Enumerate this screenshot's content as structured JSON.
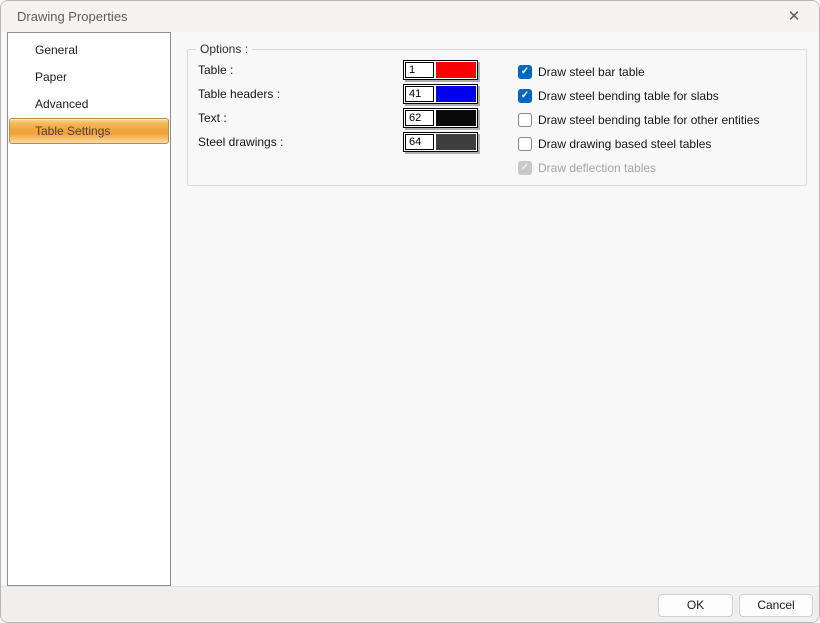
{
  "window": {
    "title": "Drawing Properties"
  },
  "icons": {
    "close": "✕",
    "check": "✓"
  },
  "sidebar": {
    "items": [
      {
        "label": "General",
        "selected": false
      },
      {
        "label": "Paper",
        "selected": false
      },
      {
        "label": "Advanced",
        "selected": false
      },
      {
        "label": "Table Settings",
        "selected": true
      }
    ]
  },
  "options": {
    "group_label": "Options :",
    "color_rows": [
      {
        "label": "Table :",
        "value": "1",
        "color": "#fb0000"
      },
      {
        "label": "Table headers :",
        "value": "41",
        "color": "#0000ee"
      },
      {
        "label": "Text :",
        "value": "62",
        "color": "#0a0a0a"
      },
      {
        "label": "Steel drawings :",
        "value": "64",
        "color": "#3e3e3e"
      }
    ],
    "checkboxes": [
      {
        "label": "Draw steel bar table",
        "checked": true,
        "disabled": false
      },
      {
        "label": "Draw steel bending table for slabs",
        "checked": true,
        "disabled": false
      },
      {
        "label": "Draw steel bending table for other entities",
        "checked": false,
        "disabled": false
      },
      {
        "label": "Draw drawing based steel tables",
        "checked": false,
        "disabled": false
      },
      {
        "label": "Draw deflection tables",
        "checked": true,
        "disabled": true
      }
    ]
  },
  "footer": {
    "ok": "OK",
    "cancel": "Cancel"
  },
  "theme": {
    "accent": "#0067c0",
    "selection_border": "#c08a3e",
    "swatch_shadow": "#aeaeae"
  }
}
